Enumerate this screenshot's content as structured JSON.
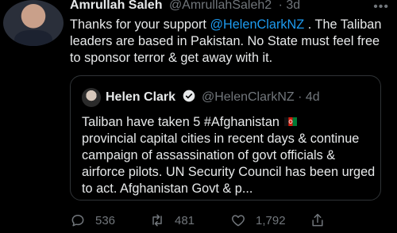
{
  "tweet": {
    "author_name": "Amrullah Saleh",
    "author_handle": "@AmrullahSaleh2",
    "time": "3d",
    "text_before_mention": "Thanks for your support ",
    "mention": "@HelenClarkNZ",
    "text_after_mention": " . The Taliban leaders are based in Pakistan. No State must feel free to sponsor terror & get away with it."
  },
  "quote": {
    "author_name": "Helen Clark",
    "author_handle": "@HelenClarkNZ",
    "time": "4d",
    "text_line1": "Taliban have taken 5 #Afghanistan",
    "text_rest": "provincial capital cities in recent days & continue campaign of assassination of govt officials & airforce pilots. UN Security Council has been urged to act. Afghanistan Govt & p..."
  },
  "actions": {
    "replies": "536",
    "retweets": "481",
    "likes": "1,792"
  },
  "colors": {
    "background": "#000000",
    "text": "#e7e9ea",
    "muted": "#71767b",
    "accent": "#1d9bf0"
  }
}
